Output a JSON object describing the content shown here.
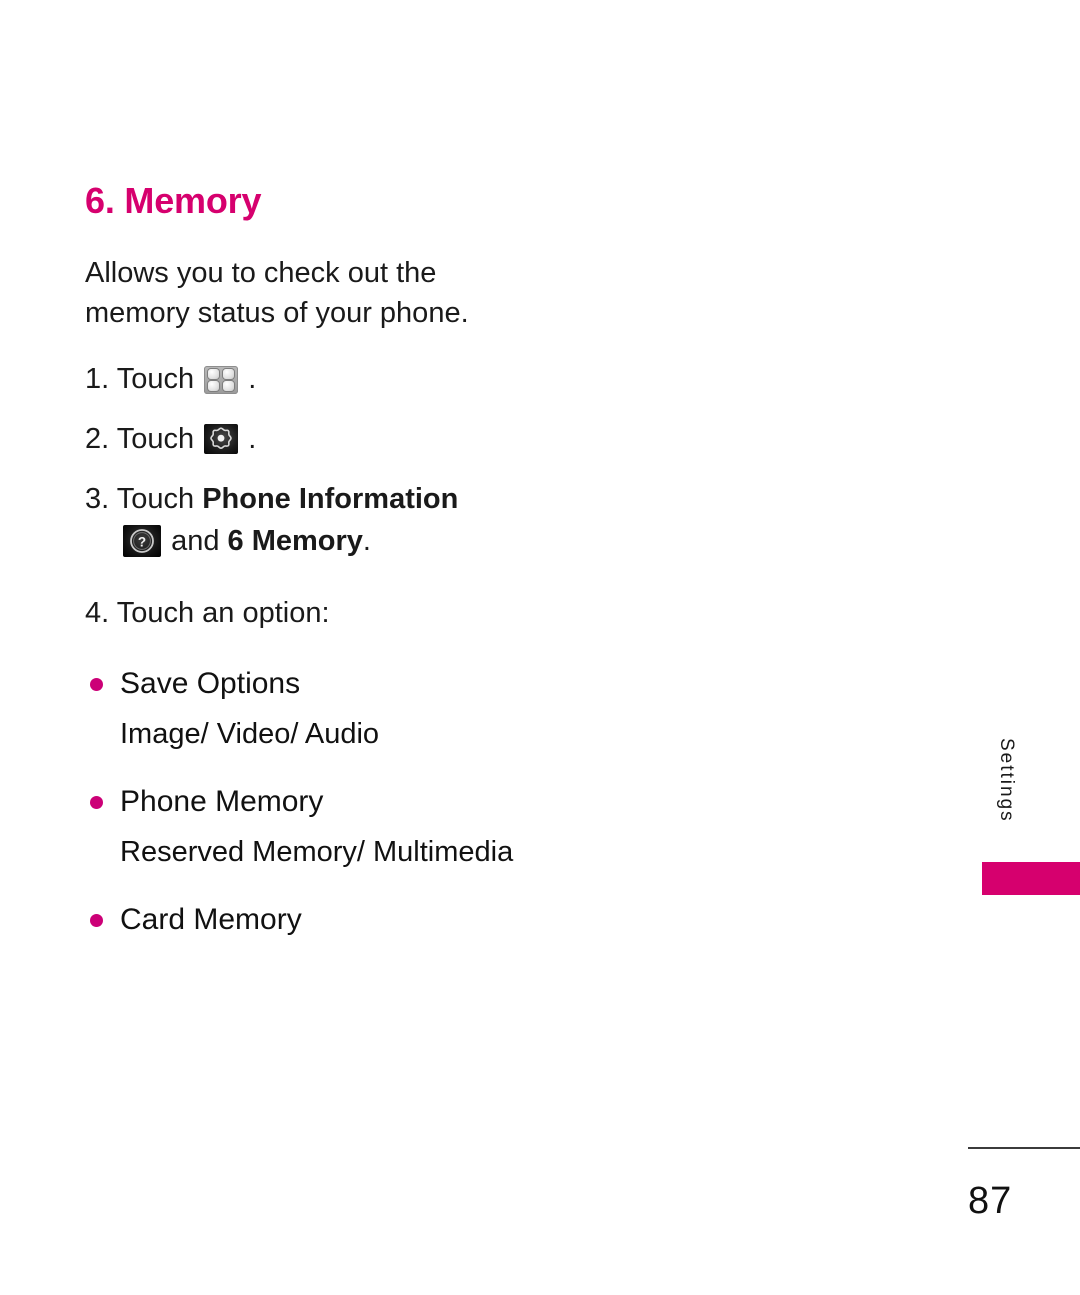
{
  "page": {
    "number": "87",
    "side_tab_label": "Settings",
    "accent_color": "#d6006e",
    "bullet_color": "#cc0077"
  },
  "section": {
    "heading": "6. Memory",
    "intro": "Allows you to check out the memory status of your phone."
  },
  "steps": [
    {
      "number": "1.",
      "lead": "Touch",
      "icon": "grid-menu-icon",
      "trailing": "."
    },
    {
      "number": "2.",
      "lead": "Touch",
      "icon": "settings-gear-icon",
      "trailing": "."
    },
    {
      "number": "3.",
      "lead": "Touch",
      "bold_target": "Phone Information",
      "icon": "help-question-icon",
      "connector": "and",
      "bold_target2": "6 Memory",
      "trailing": "."
    },
    {
      "number": "4.",
      "lead": "Touch an option:"
    }
  ],
  "options": [
    {
      "label": "Save Options",
      "detail": "Image/ Video/ Audio"
    },
    {
      "label": "Phone Memory",
      "detail": "Reserved Memory/ Multimedia"
    },
    {
      "label": "Card Memory",
      "detail": ""
    }
  ]
}
